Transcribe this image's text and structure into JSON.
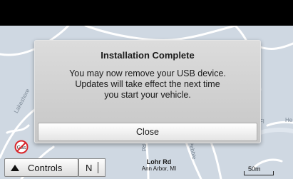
{
  "dialog": {
    "title": "Installation Complete",
    "message_lines": [
      "You may now remove your USB device.",
      "Updates will take effect the next time",
      "you start your vehicle."
    ],
    "close_label": "Close"
  },
  "bottom": {
    "controls_label": "Controls",
    "compass_heading": "N",
    "road_name": "Lohr Rd",
    "city": "Ann Arbor,  MI",
    "scale_label": "50m"
  },
  "map": {
    "street_labels": [
      "Lakeshore",
      "Fl",
      "Rd",
      "Pebble",
      "He"
    ],
    "poi_label": "Gas"
  },
  "colors": {
    "topbar": "#000000",
    "notch": "#2a9fd6",
    "map_background": "#cfd8e2",
    "road": "#ffffff",
    "no_gas": "#d9262b"
  }
}
